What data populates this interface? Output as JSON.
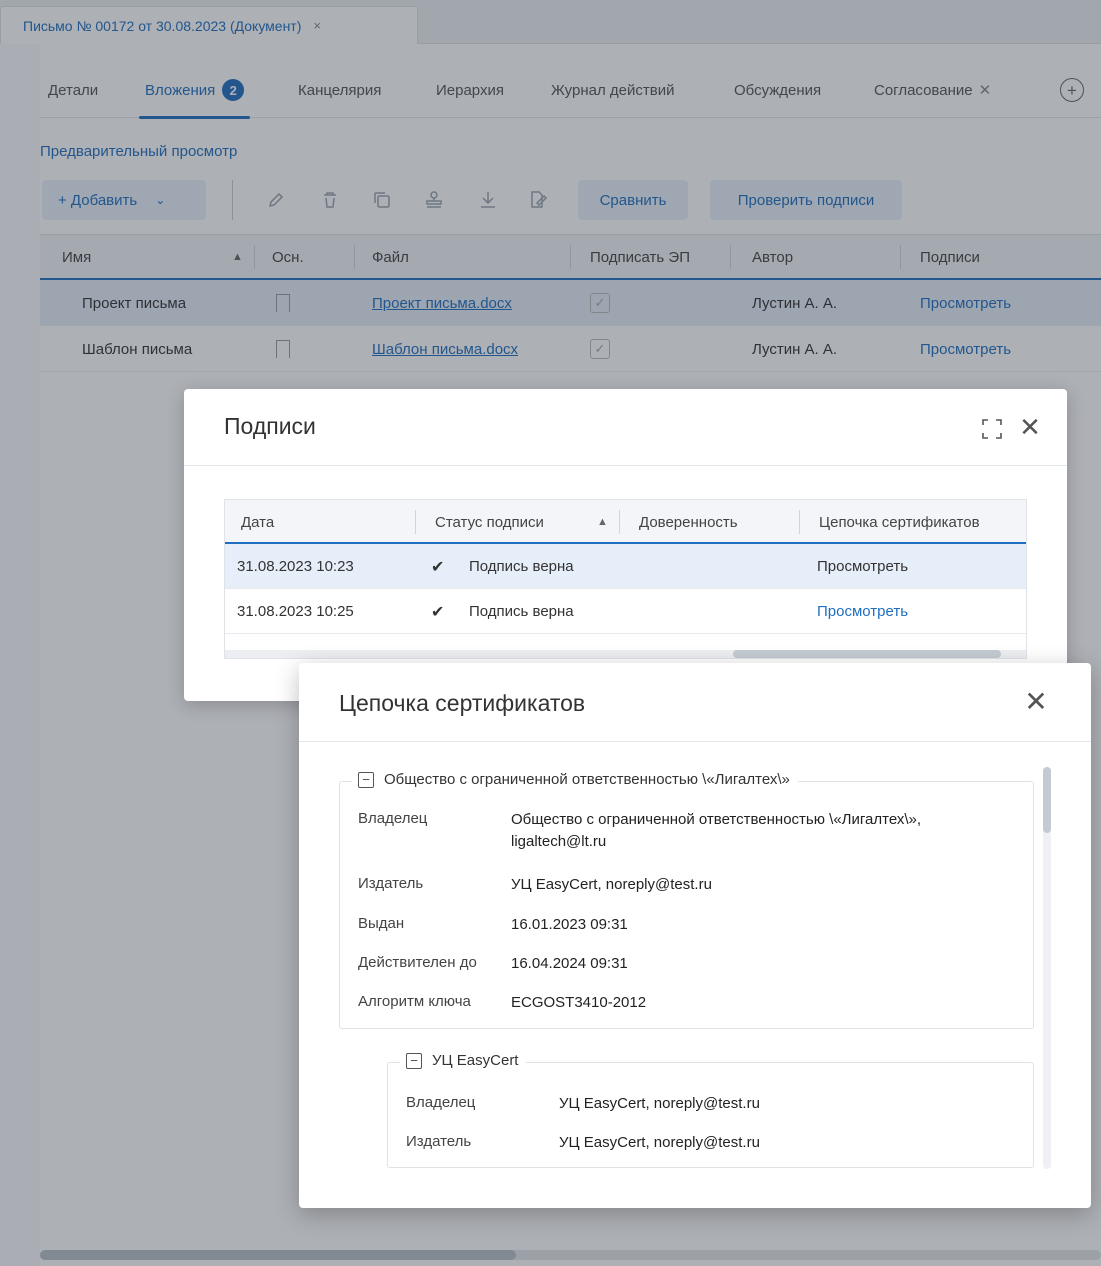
{
  "doc_tab": {
    "title": "Письмо № 00172 от 30.08.2023 (Документ)",
    "close": "×"
  },
  "tabs": [
    {
      "label": "Детали"
    },
    {
      "label": "Вложения",
      "badge": "2"
    },
    {
      "label": "Канцелярия"
    },
    {
      "label": "Иерархия"
    },
    {
      "label": "Журнал действий"
    },
    {
      "label": "Обсуждения"
    },
    {
      "label": "Согласование",
      "close": "✕"
    }
  ],
  "tab_add": "+",
  "preview_link": "Предварительный просмотр",
  "toolbar": {
    "add_label": "+ Добавить",
    "add_chevron": "⌄",
    "compare_label": "Сравнить",
    "verify_label": "Проверить подписи"
  },
  "grid": {
    "columns": [
      "Имя",
      "Осн.",
      "Файл",
      "Подписать ЭП",
      "Автор",
      "Подписи"
    ],
    "sort_indicator": "▲",
    "rows": [
      {
        "name": "Проект письма",
        "file": "Проект письма.docx",
        "author": "Лустин А. А.",
        "signatures": "Просмотреть"
      },
      {
        "name": "Шаблон письма",
        "file": "Шаблон письма.docx",
        "author": "Лустин А. А.",
        "signatures": "Просмотреть"
      }
    ]
  },
  "signatures_modal": {
    "title": "Подписи",
    "close": "✕",
    "columns": [
      "Дата",
      "Статус подписи",
      "Доверенность",
      "Цепочка сертификатов"
    ],
    "sort_indicator": "▲",
    "rows": [
      {
        "date": "31.08.2023 10:23",
        "check": "✔",
        "status": "Подпись верна",
        "chain": "Просмотреть"
      },
      {
        "date": "31.08.2023 10:25",
        "check": "✔",
        "status": "Подпись верна",
        "chain": "Просмотреть"
      }
    ]
  },
  "cert_modal": {
    "title": "Цепочка сертификатов",
    "close": "✕",
    "collapse_symbol": "−",
    "certs": [
      {
        "name": "Общество с ограниченной ответственностью \\«Лигалтех\\»",
        "fields": [
          {
            "label": "Владелец",
            "value": "Общество с ограниченной ответственностью \\«Лигалтех\\», ligaltech@lt.ru"
          },
          {
            "label": "Издатель",
            "value": "УЦ EasyCert, noreply@test.ru"
          },
          {
            "label": "Выдан",
            "value": "16.01.2023 09:31"
          },
          {
            "label": "Действителен до",
            "value": "16.04.2024 09:31"
          },
          {
            "label": "Алгоритм ключа",
            "value": "ECGOST3410-2012"
          }
        ]
      },
      {
        "name": "УЦ EasyCert",
        "fields": [
          {
            "label": "Владелец",
            "value": "УЦ EasyCert, noreply@test.ru"
          },
          {
            "label": "Издатель",
            "value": "УЦ EasyCert, noreply@test.ru"
          }
        ]
      }
    ]
  },
  "colors": {
    "accent": "#1f6fbf",
    "overlay": "rgba(40,48,60,0.38)"
  },
  "icons": [
    "pencil-icon",
    "trash-icon",
    "copy-icon",
    "stamp-icon",
    "download-icon",
    "file-sign-icon",
    "expand-icon",
    "close-icon",
    "check-icon",
    "bookmark-icon",
    "collapse-icon",
    "add-circle-icon"
  ]
}
